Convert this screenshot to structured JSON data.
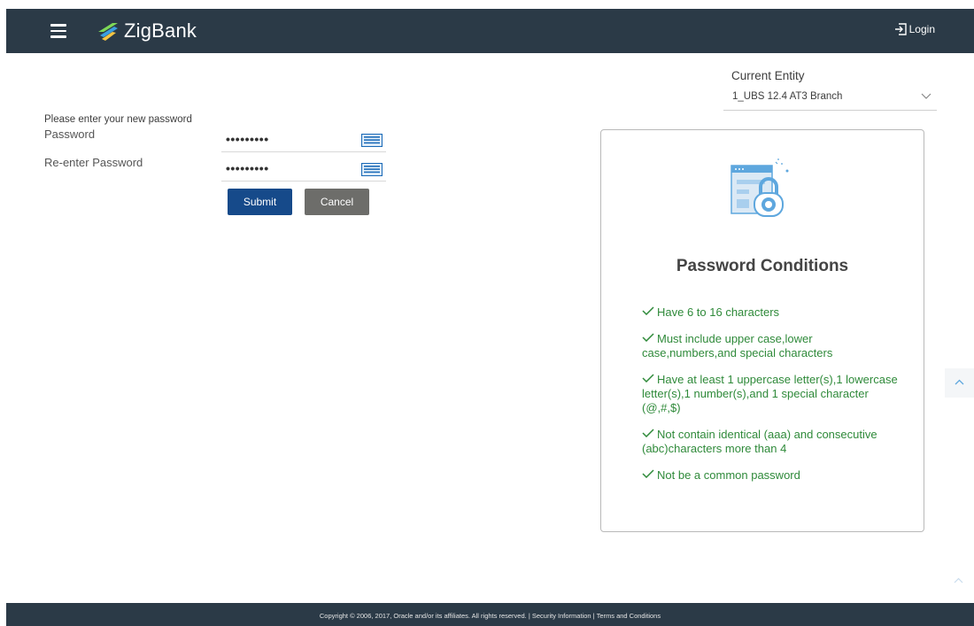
{
  "header": {
    "brand": "ZigBank",
    "login_label": "Login"
  },
  "entity": {
    "label": "Current Entity",
    "selected": "1_UBS 12.4 AT3 Branch"
  },
  "form": {
    "prompt": "Please enter your new password",
    "password_label": "Password",
    "password_value": "•••••••••",
    "reenter_label": "Re-enter Password",
    "reenter_value": "•••••••••",
    "submit_label": "Submit",
    "cancel_label": "Cancel"
  },
  "conditions": {
    "title": "Password Conditions",
    "items": [
      "Have 6 to 16 characters",
      "Must include upper case,lower case,numbers,and special characters",
      "Have at least 1 uppercase letter(s),1 lowercase letter(s),1 number(s),and 1 special character (@,#,$)",
      "Not contain identical (aaa) and consecutive (abc)characters more than 4",
      "Not be a common password"
    ]
  },
  "footer": {
    "copyright": "Copyright © 2006, 2017, Oracle and/or its affiliates. All rights reserved. |",
    "security_link": "Security Information",
    "separator": "|",
    "terms_link": "Terms and Conditions"
  },
  "colors": {
    "header_bg": "#2b3a47",
    "submit_bg": "#164a8a",
    "cancel_bg": "#6d6d6a",
    "condition_text": "#2f8a3a",
    "logo_green": "#7ed957",
    "logo_blue": "#3b9fe0"
  },
  "icons": [
    "hamburger-menu-icon",
    "zigbank-logo-icon",
    "login-icon",
    "chevron-down-icon",
    "keyboard-icon",
    "password-lock-illustration",
    "check-icon",
    "chevron-up-icon"
  ]
}
